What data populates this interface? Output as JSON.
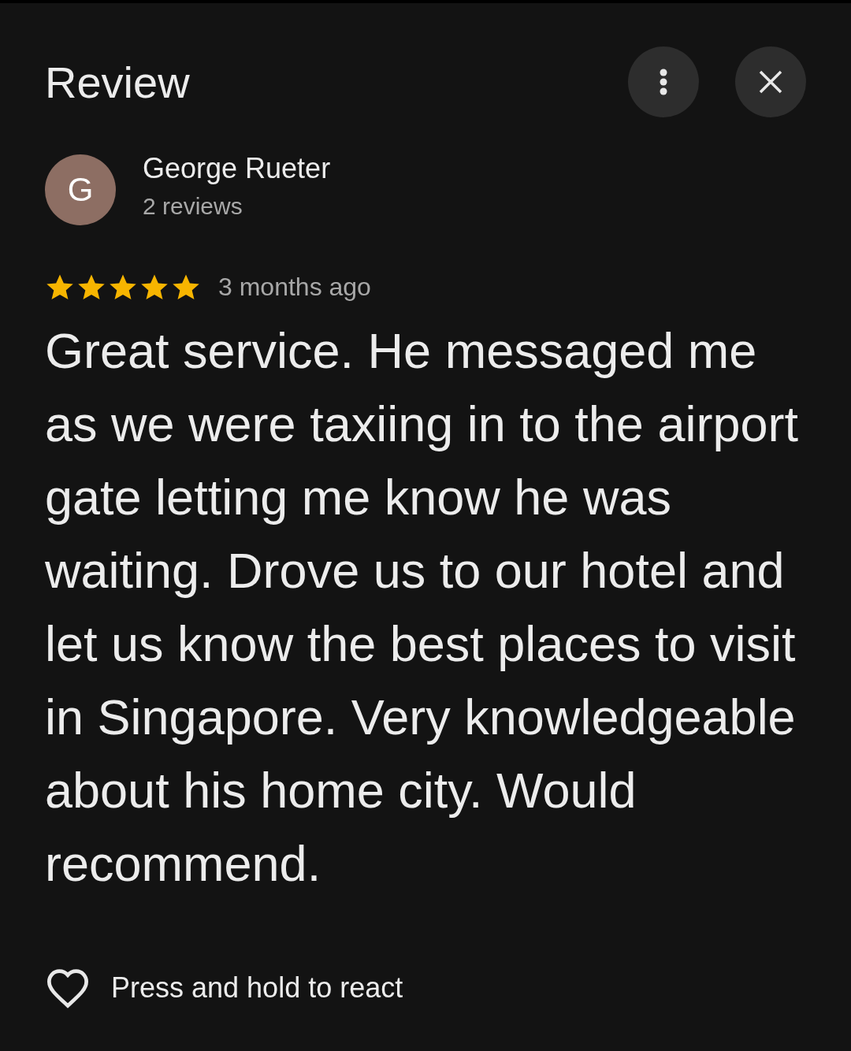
{
  "header": {
    "title": "Review"
  },
  "reviewer": {
    "initial": "G",
    "name": "George Rueter",
    "reviews": "2 reviews"
  },
  "rating": {
    "stars": 5,
    "time": "3 months ago"
  },
  "review_text": "Great service. He messaged me as we were taxiing in to the airport gate letting me know he was waiting. Drove us to our hotel and let us know the best places to visit in Singapore. Very knowledgeable about his home city. Would recommend.",
  "reaction": {
    "liked": false,
    "label": "Press and hold to react"
  }
}
